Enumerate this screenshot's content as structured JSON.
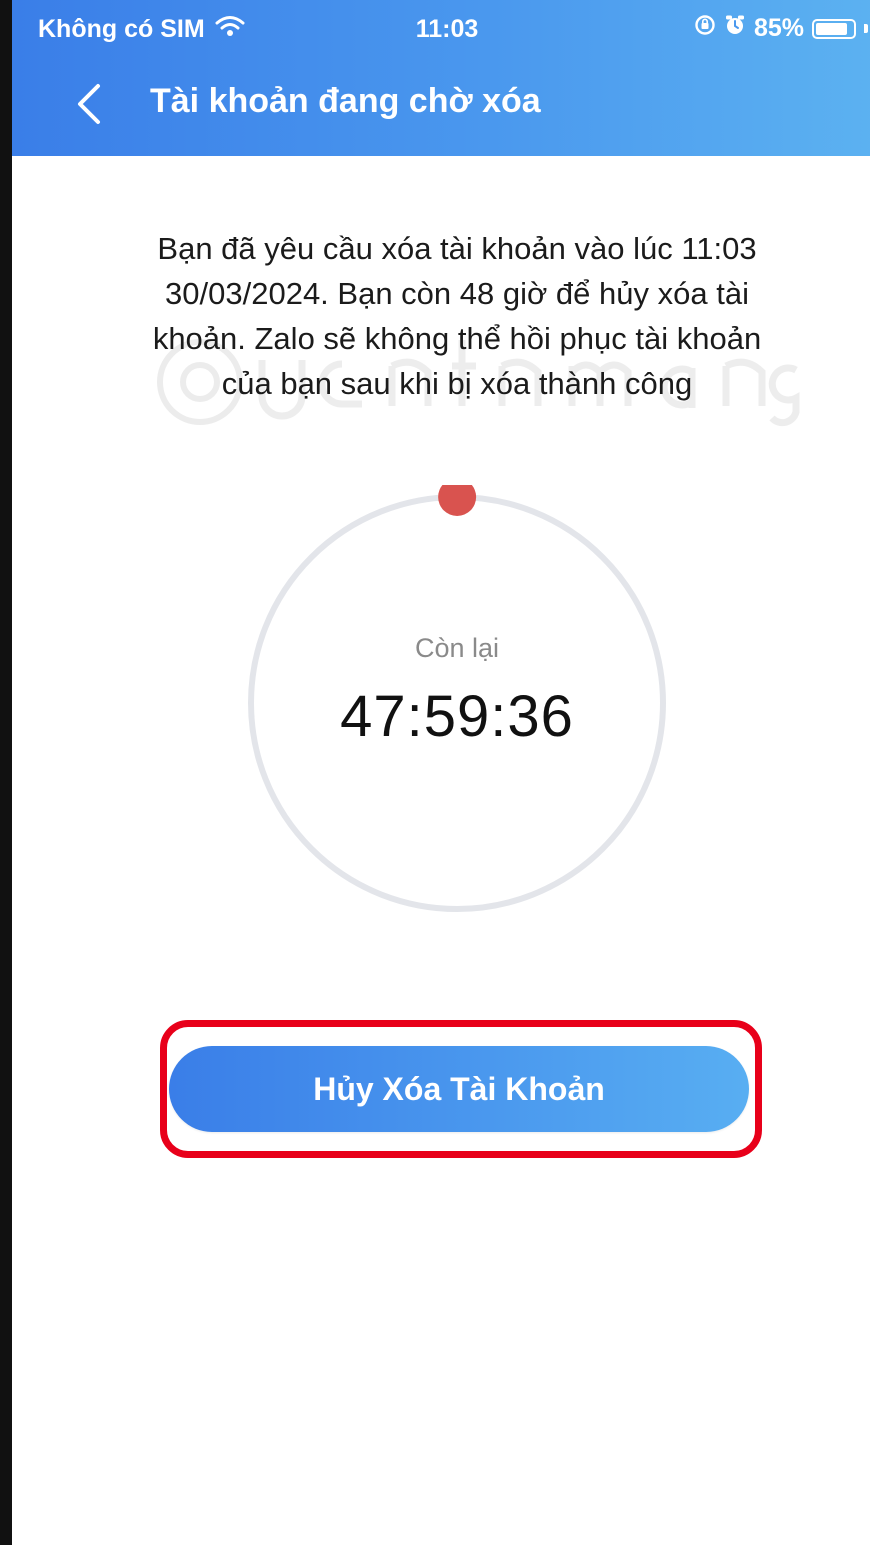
{
  "status_bar": {
    "carrier": "Không có SIM",
    "time": "11:03",
    "battery": "85%",
    "battery_level": 0.85,
    "icons": [
      "wifi-icon",
      "orientation-lock-icon",
      "alarm-icon",
      "battery-icon"
    ]
  },
  "header": {
    "title": "Tài khoản đang chờ xóa",
    "back_icon": "chevron-left-icon"
  },
  "notice": {
    "lines": [
      "Bạn đã yêu cầu xóa tài khoản vào lúc 11:03",
      "30/03/2024. Bạn còn 48 giờ để hủy xóa tài",
      "khoản. Zalo sẽ không thể hồi phục tài khoản",
      "của bạn sau khi bị xóa thành công"
    ]
  },
  "timer": {
    "label": "Còn lại",
    "value": "47:59:36",
    "elapsed_fraction": 0.0001
  },
  "actions": {
    "cancel_label": "Hủy Xóa Tài Khoản"
  },
  "colors": {
    "header_start": "#3a7ee8",
    "header_end": "#5cb2f1",
    "highlight": "#e8001a",
    "progress_dot": "#d9534f",
    "ring": "#e3e5ea"
  }
}
